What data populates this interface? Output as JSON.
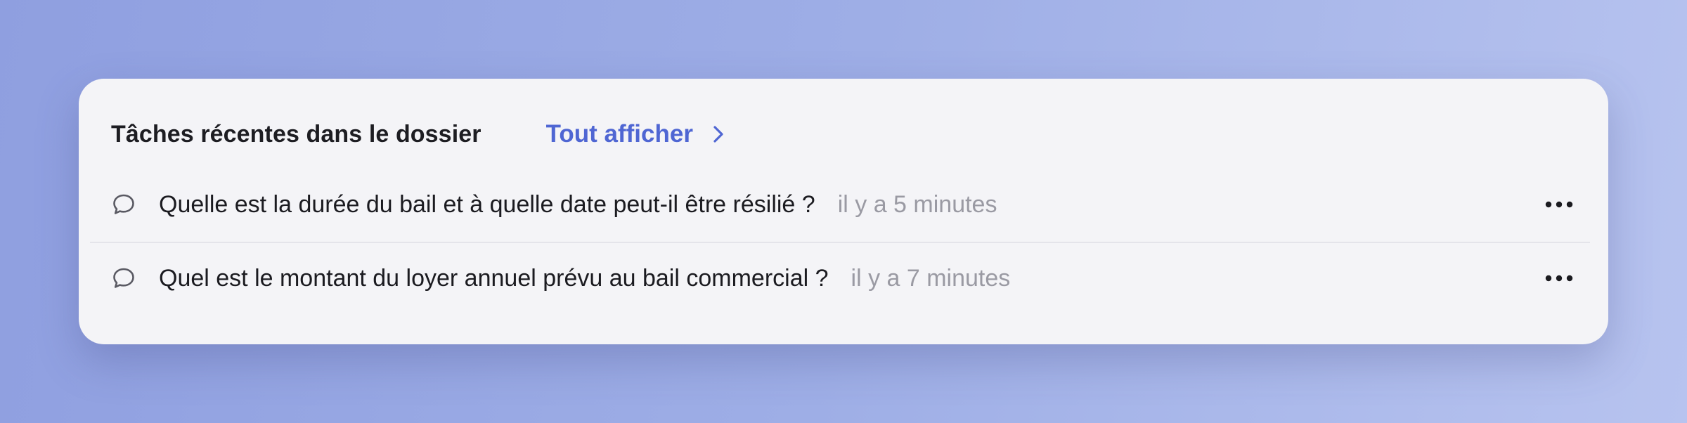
{
  "panel": {
    "title": "Tâches récentes dans le dossier",
    "view_all_label": "Tout afficher"
  },
  "tasks": [
    {
      "icon": "chat-bubble-icon",
      "title": "Quelle est la durée du bail et à quelle date peut-il être résilié ?",
      "time": "il y a 5 minutes",
      "menu_icon": "more-horizontal-icon"
    },
    {
      "icon": "chat-bubble-icon",
      "title": "Quel est le montant du loyer annuel prévu au bail commercial ?",
      "time": "il y a 7 minutes",
      "menu_icon": "more-horizontal-icon"
    }
  ],
  "colors": {
    "accent": "#4f66d3",
    "card_background": "#f4f4f7",
    "muted_text": "#9a9aa3"
  }
}
